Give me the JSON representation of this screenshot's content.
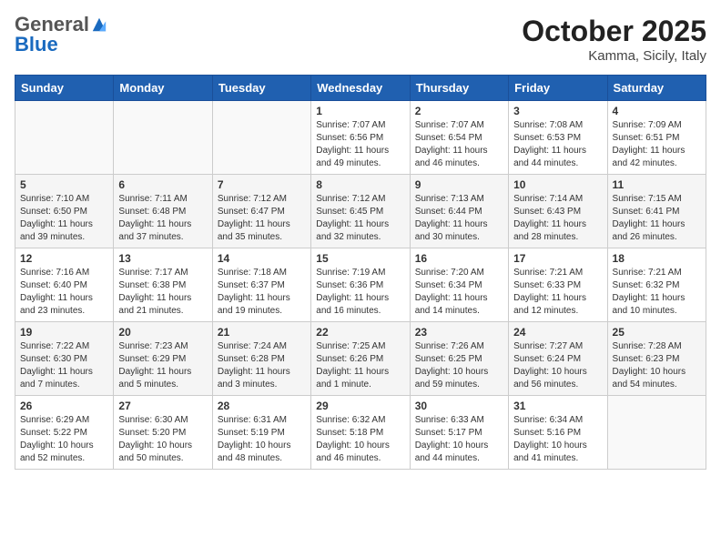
{
  "logo": {
    "general": "General",
    "blue": "Blue"
  },
  "header": {
    "month": "October 2025",
    "location": "Kamma, Sicily, Italy"
  },
  "weekdays": [
    "Sunday",
    "Monday",
    "Tuesday",
    "Wednesday",
    "Thursday",
    "Friday",
    "Saturday"
  ],
  "weeks": [
    [
      {
        "day": "",
        "info": ""
      },
      {
        "day": "",
        "info": ""
      },
      {
        "day": "",
        "info": ""
      },
      {
        "day": "1",
        "info": "Sunrise: 7:07 AM\nSunset: 6:56 PM\nDaylight: 11 hours and 49 minutes."
      },
      {
        "day": "2",
        "info": "Sunrise: 7:07 AM\nSunset: 6:54 PM\nDaylight: 11 hours and 46 minutes."
      },
      {
        "day": "3",
        "info": "Sunrise: 7:08 AM\nSunset: 6:53 PM\nDaylight: 11 hours and 44 minutes."
      },
      {
        "day": "4",
        "info": "Sunrise: 7:09 AM\nSunset: 6:51 PM\nDaylight: 11 hours and 42 minutes."
      }
    ],
    [
      {
        "day": "5",
        "info": "Sunrise: 7:10 AM\nSunset: 6:50 PM\nDaylight: 11 hours and 39 minutes."
      },
      {
        "day": "6",
        "info": "Sunrise: 7:11 AM\nSunset: 6:48 PM\nDaylight: 11 hours and 37 minutes."
      },
      {
        "day": "7",
        "info": "Sunrise: 7:12 AM\nSunset: 6:47 PM\nDaylight: 11 hours and 35 minutes."
      },
      {
        "day": "8",
        "info": "Sunrise: 7:12 AM\nSunset: 6:45 PM\nDaylight: 11 hours and 32 minutes."
      },
      {
        "day": "9",
        "info": "Sunrise: 7:13 AM\nSunset: 6:44 PM\nDaylight: 11 hours and 30 minutes."
      },
      {
        "day": "10",
        "info": "Sunrise: 7:14 AM\nSunset: 6:43 PM\nDaylight: 11 hours and 28 minutes."
      },
      {
        "day": "11",
        "info": "Sunrise: 7:15 AM\nSunset: 6:41 PM\nDaylight: 11 hours and 26 minutes."
      }
    ],
    [
      {
        "day": "12",
        "info": "Sunrise: 7:16 AM\nSunset: 6:40 PM\nDaylight: 11 hours and 23 minutes."
      },
      {
        "day": "13",
        "info": "Sunrise: 7:17 AM\nSunset: 6:38 PM\nDaylight: 11 hours and 21 minutes."
      },
      {
        "day": "14",
        "info": "Sunrise: 7:18 AM\nSunset: 6:37 PM\nDaylight: 11 hours and 19 minutes."
      },
      {
        "day": "15",
        "info": "Sunrise: 7:19 AM\nSunset: 6:36 PM\nDaylight: 11 hours and 16 minutes."
      },
      {
        "day": "16",
        "info": "Sunrise: 7:20 AM\nSunset: 6:34 PM\nDaylight: 11 hours and 14 minutes."
      },
      {
        "day": "17",
        "info": "Sunrise: 7:21 AM\nSunset: 6:33 PM\nDaylight: 11 hours and 12 minutes."
      },
      {
        "day": "18",
        "info": "Sunrise: 7:21 AM\nSunset: 6:32 PM\nDaylight: 11 hours and 10 minutes."
      }
    ],
    [
      {
        "day": "19",
        "info": "Sunrise: 7:22 AM\nSunset: 6:30 PM\nDaylight: 11 hours and 7 minutes."
      },
      {
        "day": "20",
        "info": "Sunrise: 7:23 AM\nSunset: 6:29 PM\nDaylight: 11 hours and 5 minutes."
      },
      {
        "day": "21",
        "info": "Sunrise: 7:24 AM\nSunset: 6:28 PM\nDaylight: 11 hours and 3 minutes."
      },
      {
        "day": "22",
        "info": "Sunrise: 7:25 AM\nSunset: 6:26 PM\nDaylight: 11 hours and 1 minute."
      },
      {
        "day": "23",
        "info": "Sunrise: 7:26 AM\nSunset: 6:25 PM\nDaylight: 10 hours and 59 minutes."
      },
      {
        "day": "24",
        "info": "Sunrise: 7:27 AM\nSunset: 6:24 PM\nDaylight: 10 hours and 56 minutes."
      },
      {
        "day": "25",
        "info": "Sunrise: 7:28 AM\nSunset: 6:23 PM\nDaylight: 10 hours and 54 minutes."
      }
    ],
    [
      {
        "day": "26",
        "info": "Sunrise: 6:29 AM\nSunset: 5:22 PM\nDaylight: 10 hours and 52 minutes."
      },
      {
        "day": "27",
        "info": "Sunrise: 6:30 AM\nSunset: 5:20 PM\nDaylight: 10 hours and 50 minutes."
      },
      {
        "day": "28",
        "info": "Sunrise: 6:31 AM\nSunset: 5:19 PM\nDaylight: 10 hours and 48 minutes."
      },
      {
        "day": "29",
        "info": "Sunrise: 6:32 AM\nSunset: 5:18 PM\nDaylight: 10 hours and 46 minutes."
      },
      {
        "day": "30",
        "info": "Sunrise: 6:33 AM\nSunset: 5:17 PM\nDaylight: 10 hours and 44 minutes."
      },
      {
        "day": "31",
        "info": "Sunrise: 6:34 AM\nSunset: 5:16 PM\nDaylight: 10 hours and 41 minutes."
      },
      {
        "day": "",
        "info": ""
      }
    ]
  ]
}
